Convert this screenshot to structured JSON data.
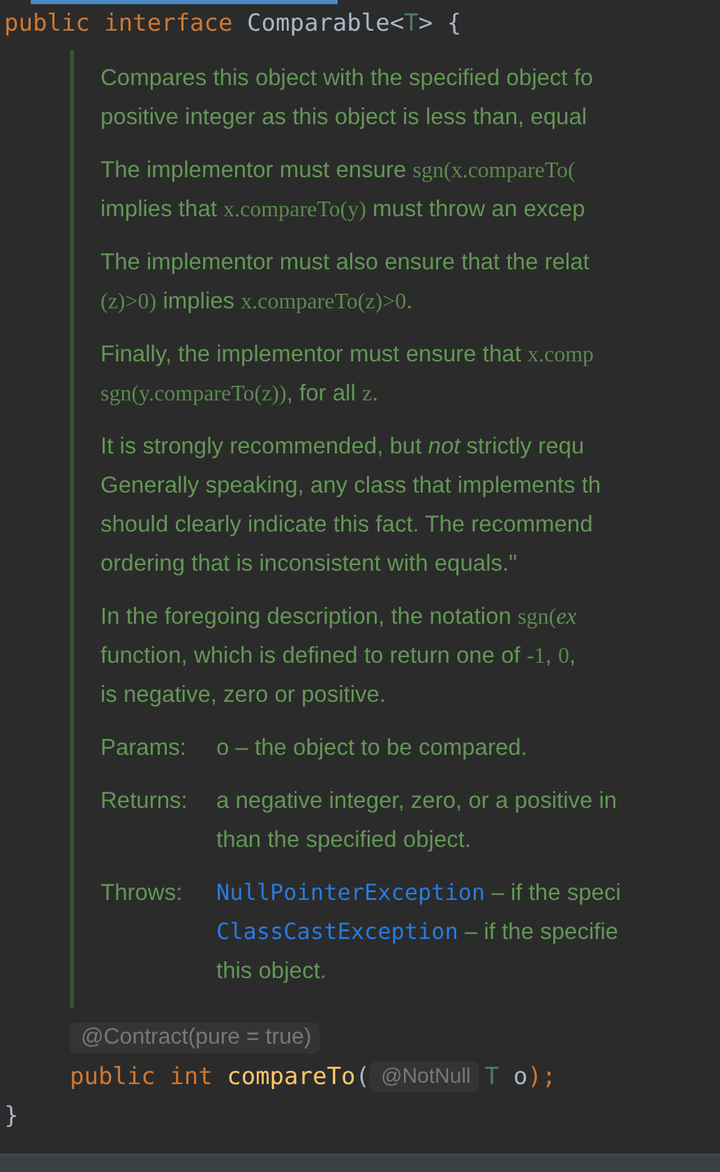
{
  "header_code": [
    {
      "kind": "keyword",
      "text": "public interface "
    },
    {
      "kind": "type",
      "text": "Comparable<"
    },
    {
      "kind": "typeparam",
      "text": "T"
    },
    {
      "kind": "type",
      "text": "> {"
    }
  ],
  "doc": {
    "paragraphs": [
      [
        [
          {
            "kind": "text",
            "text": "Compares this object with the specified object fo"
          }
        ],
        [
          {
            "kind": "text",
            "text": "positive integer as this object is less than, equal"
          }
        ]
      ],
      [
        [
          {
            "kind": "text",
            "text": "The implementor must ensure "
          },
          {
            "kind": "code",
            "text": "sgn(x.compareTo("
          }
        ],
        [
          {
            "kind": "text",
            "text": "implies that "
          },
          {
            "kind": "code",
            "text": "x.compareTo(y)"
          },
          {
            "kind": "text",
            "text": " must throw an excep"
          }
        ]
      ],
      [
        [
          {
            "kind": "text",
            "text": "The implementor must also ensure that the relat"
          }
        ],
        [
          {
            "kind": "code",
            "text": "(z)>0)"
          },
          {
            "kind": "text",
            "text": " implies "
          },
          {
            "kind": "code",
            "text": "x.compareTo(z)>0"
          },
          {
            "kind": "text",
            "text": "."
          }
        ]
      ],
      [
        [
          {
            "kind": "text",
            "text": "Finally, the implementor must ensure that "
          },
          {
            "kind": "code",
            "text": "x.comp"
          }
        ],
        [
          {
            "kind": "code",
            "text": "sgn(y.compareTo(z))"
          },
          {
            "kind": "text",
            "text": ", for all "
          },
          {
            "kind": "code",
            "text": "z"
          },
          {
            "kind": "text",
            "text": "."
          }
        ]
      ],
      [
        [
          {
            "kind": "text",
            "text": "It is strongly recommended, but "
          },
          {
            "kind": "em",
            "text": "not"
          },
          {
            "kind": "text",
            "text": " strictly requ"
          }
        ],
        [
          {
            "kind": "text",
            "text": "Generally speaking, any class that implements th"
          }
        ],
        [
          {
            "kind": "text",
            "text": "should clearly indicate this fact. The recommend"
          }
        ],
        [
          {
            "kind": "text",
            "text": "ordering that is inconsistent with equals.\""
          }
        ]
      ],
      [
        [
          {
            "kind": "text",
            "text": "In the foregoing description, the notation "
          },
          {
            "kind": "code",
            "text": "sgn("
          },
          {
            "kind": "emcode",
            "text": "ex"
          }
        ],
        [
          {
            "kind": "text",
            "text": "function, which is defined to return one of "
          },
          {
            "kind": "code",
            "text": "-1"
          },
          {
            "kind": "text",
            "text": ", "
          },
          {
            "kind": "code",
            "text": "0"
          },
          {
            "kind": "text",
            "text": ","
          }
        ],
        [
          {
            "kind": "text",
            "text": "is negative, zero or positive."
          }
        ]
      ]
    ],
    "tags": [
      {
        "label": "Params:",
        "lines": [
          [
            {
              "kind": "text",
              "text": "o – the object to be compared."
            }
          ]
        ]
      },
      {
        "label": "Returns:",
        "lines": [
          [
            {
              "kind": "text",
              "text": "a negative integer, zero, or a positive in"
            }
          ],
          [
            {
              "kind": "text",
              "text": "than the specified object."
            }
          ]
        ]
      },
      {
        "label": "Throws:",
        "lines": [
          [
            {
              "kind": "link",
              "text": "NullPointerException"
            },
            {
              "kind": "text",
              "text": " – if the speci"
            }
          ],
          [
            {
              "kind": "link",
              "text": "ClassCastException"
            },
            {
              "kind": "text",
              "text": " – if the specifie"
            }
          ],
          [
            {
              "kind": "text",
              "text": "this object."
            }
          ]
        ]
      }
    ]
  },
  "annotation_hint": "@Contract(pure = true)",
  "method_code": [
    {
      "kind": "keyword",
      "text": "public int "
    },
    {
      "kind": "method",
      "text": "compareTo"
    },
    {
      "kind": "plain",
      "text": "("
    },
    {
      "kind": "hint",
      "text": "@NotNull"
    },
    {
      "kind": "typeparam",
      "text": "T"
    },
    {
      "kind": "plain",
      "text": " o"
    },
    {
      "kind": "keyword",
      "text": ");"
    }
  ],
  "closing_code": "}"
}
